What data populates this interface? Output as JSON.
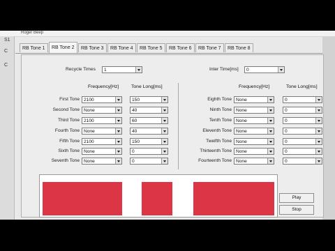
{
  "window": {
    "title": "Roger Beep"
  },
  "left_strip_labels": [
    "S1",
    "C",
    "C"
  ],
  "tabs": [
    "RB Tone 1",
    "RB Tone 2",
    "RB Tone 3",
    "RB Tone 4",
    "RB Tone 5",
    "RB Tone 6",
    "RB Tone 7",
    "RB Tone 8"
  ],
  "active_tab": "RB Tone 2",
  "recycle": {
    "label": "Recycle Times",
    "value": "1"
  },
  "inter_time": {
    "label": "Inter Time[ms]",
    "value": "0"
  },
  "headers": {
    "frequency": "Frequency[Hz]",
    "tone_long": "Tone Long[ms]"
  },
  "tones_left": [
    {
      "label": "First Tone",
      "frequency": "2100",
      "long": "150"
    },
    {
      "label": "Second Tone",
      "frequency": "None",
      "long": "40"
    },
    {
      "label": "Third Tone",
      "frequency": "2100",
      "long": "60"
    },
    {
      "label": "Fourth Tone",
      "frequency": "None",
      "long": "40"
    },
    {
      "label": "Fifth Tone",
      "frequency": "2100",
      "long": "150"
    },
    {
      "label": "Sixth Tone",
      "frequency": "None",
      "long": "0"
    },
    {
      "label": "Seventh Tone",
      "frequency": "None",
      "long": "0"
    }
  ],
  "tones_right": [
    {
      "label": "Eighth Tone",
      "frequency": "None",
      "long": "0"
    },
    {
      "label": "Ninth Tone",
      "frequency": "None",
      "long": "0"
    },
    {
      "label": "Tenth Tone",
      "frequency": "None",
      "long": "0"
    },
    {
      "label": "Eleventh Tone",
      "frequency": "None",
      "long": "0"
    },
    {
      "label": "Twelfth Tone",
      "frequency": "None",
      "long": "0"
    },
    {
      "label": "Thirteenth Tone",
      "frequency": "None",
      "long": "0"
    },
    {
      "label": "Fourteenth Tone",
      "frequency": "None",
      "long": "0"
    }
  ],
  "buttons": {
    "play": "Play",
    "stop": "Stop"
  },
  "colors": {
    "tone_bar": "#dc3545",
    "display_bg": "#ffffff"
  }
}
